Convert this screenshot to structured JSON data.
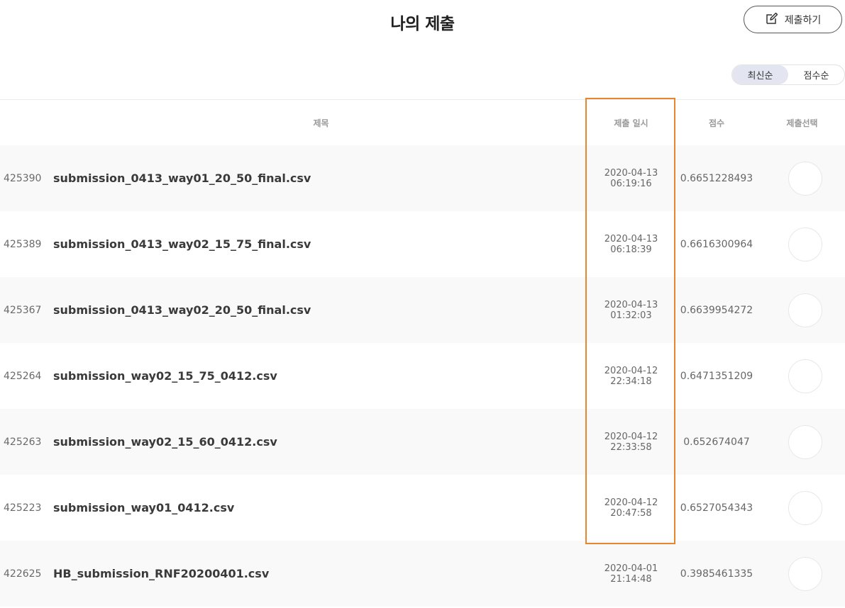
{
  "header": {
    "title": "나의 제출",
    "submit_label": "제출하기"
  },
  "sort": {
    "options": [
      {
        "label": "최신순",
        "active": true
      },
      {
        "label": "점수순",
        "active": false
      }
    ]
  },
  "table": {
    "columns": {
      "title": "제목",
      "date": "제출 일시",
      "score": "점수",
      "select": "제출선택"
    },
    "rows": [
      {
        "id": "425390",
        "filename": "submission_0413_way01_20_50_final.csv",
        "date": "2020-04-13",
        "time": "06:19:16",
        "score": "0.6651228493"
      },
      {
        "id": "425389",
        "filename": "submission_0413_way02_15_75_final.csv",
        "date": "2020-04-13",
        "time": "06:18:39",
        "score": "0.6616300964"
      },
      {
        "id": "425367",
        "filename": "submission_0413_way02_20_50_final.csv",
        "date": "2020-04-13",
        "time": "01:32:03",
        "score": "0.6639954272"
      },
      {
        "id": "425264",
        "filename": "submission_way02_15_75_0412.csv",
        "date": "2020-04-12",
        "time": "22:34:18",
        "score": "0.6471351209"
      },
      {
        "id": "425263",
        "filename": "submission_way02_15_60_0412.csv",
        "date": "2020-04-12",
        "time": "22:33:58",
        "score": "0.652674047"
      },
      {
        "id": "425223",
        "filename": "submission_way01_0412.csv",
        "date": "2020-04-12",
        "time": "20:47:58",
        "score": "0.6527054343"
      },
      {
        "id": "422625",
        "filename": "HB_submission_RNF20200401.csv",
        "date": "2020-04-01",
        "time": "21:14:48",
        "score": "0.3985461335"
      }
    ]
  },
  "colors": {
    "highlight": "#e8862f",
    "active_sort_bg": "#e3e6f0",
    "alt_row_bg": "#f9f9f9"
  },
  "icons": {
    "submit": "edit-icon"
  }
}
